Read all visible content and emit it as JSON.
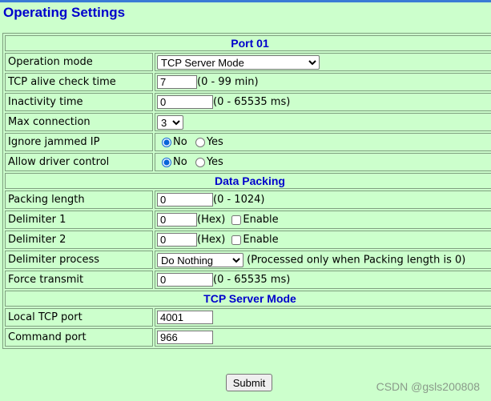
{
  "page_title": "Operating Settings",
  "sections": {
    "port": "Port 01",
    "data_packing": "Data Packing",
    "tcp_server_mode": "TCP Server Mode"
  },
  "operation_mode": {
    "label": "Operation mode",
    "value": "TCP Server Mode"
  },
  "tcp_alive_check_time": {
    "label": "TCP alive check time",
    "value": "7",
    "hint": "(0 - 99 min)"
  },
  "inactivity_time": {
    "label": "Inactivity time",
    "value": "0",
    "hint": "(0 - 65535 ms)"
  },
  "max_connection": {
    "label": "Max connection",
    "value": "3"
  },
  "ignore_jammed_ip": {
    "label": "Ignore jammed IP",
    "option_no": "No",
    "option_yes": "Yes",
    "selected": "No"
  },
  "allow_driver_control": {
    "label": "Allow driver control",
    "option_no": "No",
    "option_yes": "Yes",
    "selected": "No"
  },
  "packing_length": {
    "label": "Packing length",
    "value": "0",
    "hint": "(0 - 1024)"
  },
  "delimiter_1": {
    "label": "Delimiter 1",
    "value": "0",
    "unit": "(Hex)",
    "enable_label": "Enable",
    "enabled": false
  },
  "delimiter_2": {
    "label": "Delimiter 2",
    "value": "0",
    "unit": "(Hex)",
    "enable_label": "Enable",
    "enabled": false
  },
  "delimiter_process": {
    "label": "Delimiter process",
    "value": "Do Nothing",
    "hint": "(Processed only when Packing length is 0)"
  },
  "force_transmit": {
    "label": "Force transmit",
    "value": "0",
    "hint": "(0 - 65535 ms)"
  },
  "local_tcp_port": {
    "label": "Local TCP port",
    "value": "4001"
  },
  "command_port": {
    "label": "Command port",
    "value": "966"
  },
  "submit_label": "Submit",
  "watermark": "CSDN @gsls200808",
  "colors": {
    "background": "#ccffcc",
    "heading": "#0000cc",
    "top_border": "#3a7bd5"
  }
}
